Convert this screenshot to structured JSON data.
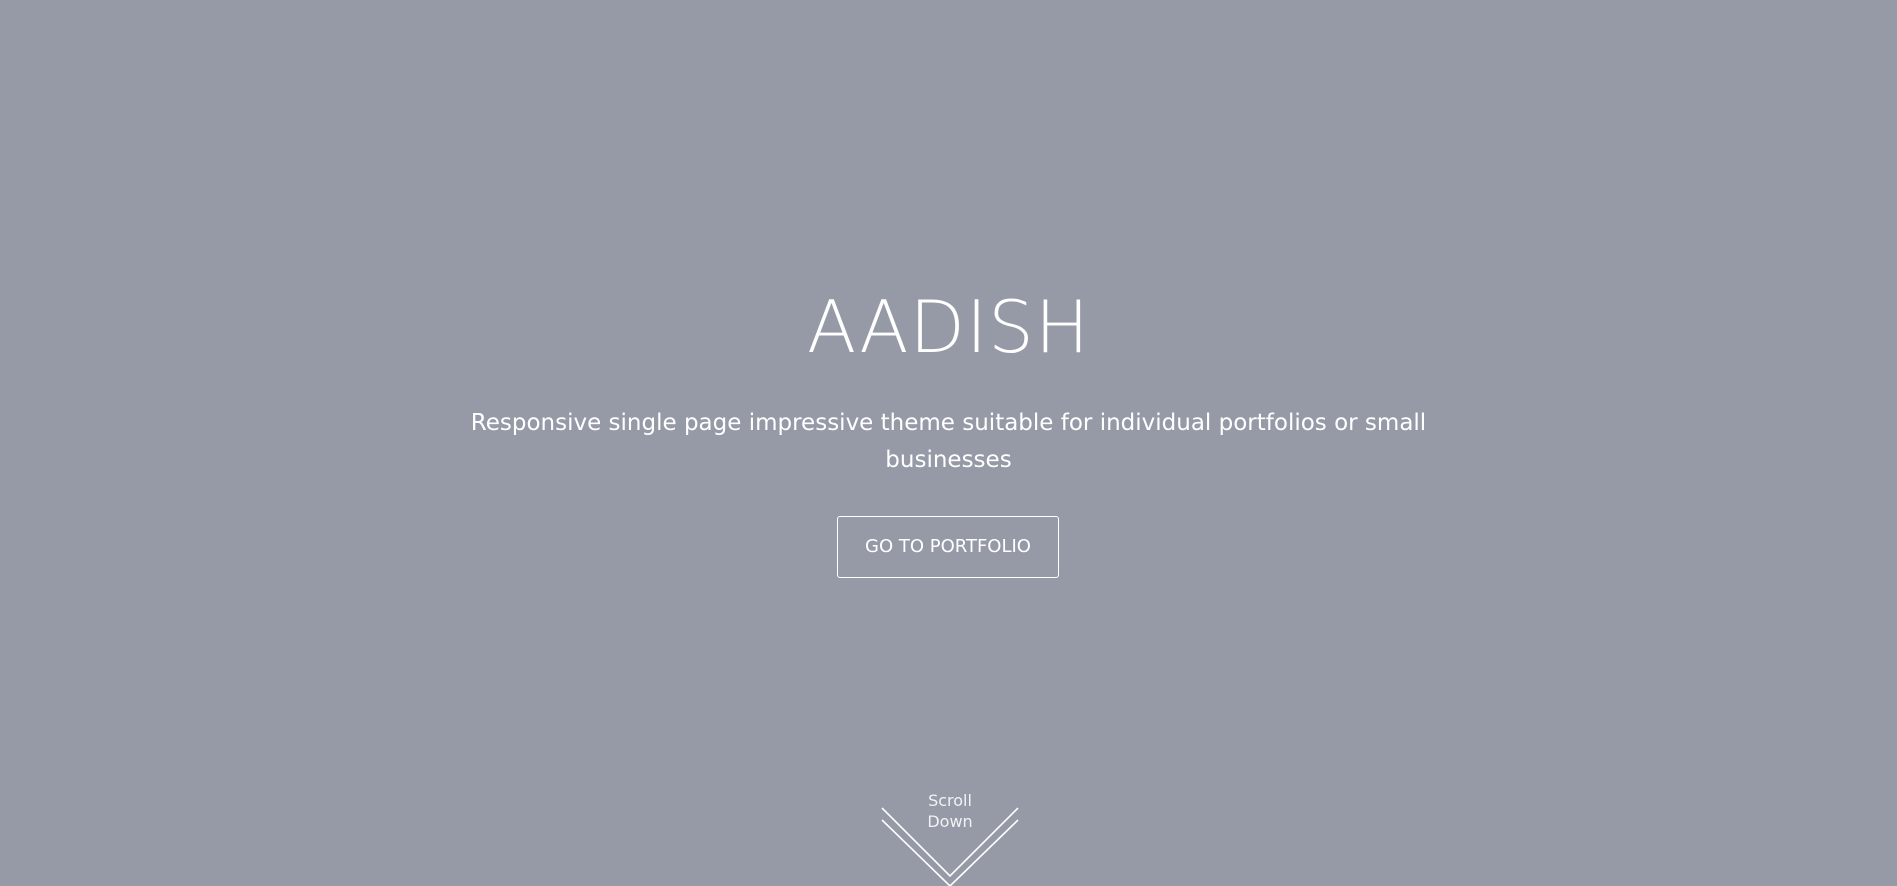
{
  "hero": {
    "title": "AADISH",
    "subtitle": "Responsive single page impressive theme suitable for individual portfolios or small businesses",
    "cta_label": "GO TO PORTFOLIO",
    "scroll_line1": "Scroll",
    "scroll_line2": "Down",
    "scroll_icon": "double-chevron-down-icon"
  },
  "colors": {
    "background": "#959aa6",
    "text": "#ffffff"
  }
}
